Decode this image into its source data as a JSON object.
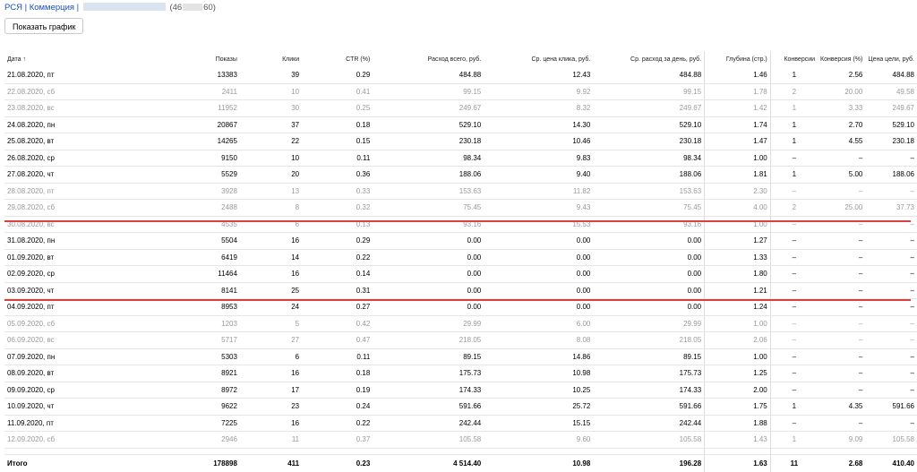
{
  "breadcrumb": {
    "text": "РСЯ | Коммерция |",
    "id_start": "(46",
    "id_end": "60)"
  },
  "toolbar": {
    "show_chart_label": "Показать график"
  },
  "table": {
    "columns": [
      "Дата ↑",
      "Показы",
      "Клики",
      "CTR (%)",
      "Расход всего, руб.",
      "Ср. цена клика, руб.",
      "Ср. расход за день, руб.",
      "Глубина (стр.)",
      "Конверсии",
      "Конверсия (%)",
      "Цена цели, руб."
    ],
    "rows": [
      {
        "weekend": false,
        "cells": [
          "21.08.2020, пт",
          "13383",
          "39",
          "0.29",
          "484.88",
          "12.43",
          "484.88",
          "1.46",
          "1",
          "2.56",
          "484.88"
        ]
      },
      {
        "weekend": true,
        "cells": [
          "22.08.2020, сб",
          "2411",
          "10",
          "0.41",
          "99.15",
          "9.92",
          "99.15",
          "1.78",
          "2",
          "20.00",
          "49.58"
        ]
      },
      {
        "weekend": true,
        "cells": [
          "23.08.2020, вс",
          "11952",
          "30",
          "0.25",
          "249.67",
          "8.32",
          "249.67",
          "1.42",
          "1",
          "3.33",
          "249.67"
        ]
      },
      {
        "weekend": false,
        "cells": [
          "24.08.2020, пн",
          "20867",
          "37",
          "0.18",
          "529.10",
          "14.30",
          "529.10",
          "1.74",
          "1",
          "2.70",
          "529.10"
        ]
      },
      {
        "weekend": false,
        "cells": [
          "25.08.2020, вт",
          "14265",
          "22",
          "0.15",
          "230.18",
          "10.46",
          "230.18",
          "1.47",
          "1",
          "4.55",
          "230.18"
        ]
      },
      {
        "weekend": false,
        "cells": [
          "26.08.2020, ср",
          "9150",
          "10",
          "0.11",
          "98.34",
          "9.83",
          "98.34",
          "1.00",
          "–",
          "–",
          "–"
        ]
      },
      {
        "weekend": false,
        "cells": [
          "27.08.2020, чт",
          "5529",
          "20",
          "0.36",
          "188.06",
          "9.40",
          "188.06",
          "1.81",
          "1",
          "5.00",
          "188.06"
        ]
      },
      {
        "weekend": true,
        "cells": [
          "28.08.2020, пт",
          "3928",
          "13",
          "0.33",
          "153.63",
          "11.82",
          "153.63",
          "2.30",
          "–",
          "–",
          "–"
        ]
      },
      {
        "weekend": true,
        "cells": [
          "29.08.2020, сб",
          "2488",
          "8",
          "0.32",
          "75.45",
          "9.43",
          "75.45",
          "4.00",
          "2",
          "25.00",
          "37.73"
        ]
      },
      {
        "weekend": true,
        "cells": [
          "30.08.2020, вс",
          "4535",
          "6",
          "0.13",
          "93.16",
          "15.53",
          "93.16",
          "1.00",
          "–",
          "–",
          "–"
        ]
      },
      {
        "weekend": false,
        "cells": [
          "31.08.2020, пн",
          "5504",
          "16",
          "0.29",
          "0.00",
          "0.00",
          "0.00",
          "1.27",
          "–",
          "–",
          "–"
        ]
      },
      {
        "weekend": false,
        "cells": [
          "01.09.2020, вт",
          "6419",
          "14",
          "0.22",
          "0.00",
          "0.00",
          "0.00",
          "1.33",
          "–",
          "–",
          "–"
        ]
      },
      {
        "weekend": false,
        "cells": [
          "02.09.2020, ср",
          "11464",
          "16",
          "0.14",
          "0.00",
          "0.00",
          "0.00",
          "1.80",
          "–",
          "–",
          "–"
        ]
      },
      {
        "weekend": false,
        "cells": [
          "03.09.2020, чт",
          "8141",
          "25",
          "0.31",
          "0.00",
          "0.00",
          "0.00",
          "1.21",
          "–",
          "–",
          "–"
        ]
      },
      {
        "weekend": false,
        "cells": [
          "04.09.2020, пт",
          "8953",
          "24",
          "0.27",
          "0.00",
          "0.00",
          "0.00",
          "1.24",
          "–",
          "–",
          "–"
        ]
      },
      {
        "weekend": true,
        "cells": [
          "05.09.2020, сб",
          "1203",
          "5",
          "0.42",
          "29.99",
          "6.00",
          "29.99",
          "1.00",
          "–",
          "–",
          "–"
        ]
      },
      {
        "weekend": true,
        "cells": [
          "06.09.2020, вс",
          "5717",
          "27",
          "0.47",
          "218.05",
          "8.08",
          "218.05",
          "2.06",
          "–",
          "–",
          "–"
        ]
      },
      {
        "weekend": false,
        "cells": [
          "07.09.2020, пн",
          "5303",
          "6",
          "0.11",
          "89.15",
          "14.86",
          "89.15",
          "1.00",
          "–",
          "–",
          "–"
        ]
      },
      {
        "weekend": false,
        "cells": [
          "08.09.2020, вт",
          "8921",
          "16",
          "0.18",
          "175.73",
          "10.98",
          "175.73",
          "1.25",
          "–",
          "–",
          "–"
        ]
      },
      {
        "weekend": false,
        "cells": [
          "09.09.2020, ср",
          "8972",
          "17",
          "0.19",
          "174.33",
          "10.25",
          "174.33",
          "2.00",
          "–",
          "–",
          "–"
        ]
      },
      {
        "weekend": false,
        "cells": [
          "10.09.2020, чт",
          "9622",
          "23",
          "0.24",
          "591.66",
          "25.72",
          "591.66",
          "1.75",
          "1",
          "4.35",
          "591.66"
        ]
      },
      {
        "weekend": false,
        "cells": [
          "11.09.2020, пт",
          "7225",
          "16",
          "0.22",
          "242.44",
          "15.15",
          "242.44",
          "1.88",
          "–",
          "–",
          "–"
        ]
      },
      {
        "weekend": true,
        "cells": [
          "12.09.2020, сб",
          "2946",
          "11",
          "0.37",
          "105.58",
          "9.60",
          "105.58",
          "1.43",
          "1",
          "9.09",
          "105.58"
        ]
      }
    ],
    "total": [
      "Итого",
      "178898",
      "411",
      "0.23",
      "4 514.40",
      "10.98",
      "196.28",
      "1.63",
      "11",
      "2.68",
      "410.40"
    ]
  },
  "colors": {
    "link": "#1a4fb8",
    "highlight_line": "#d94040",
    "muted_text": "#9a9a9a"
  }
}
